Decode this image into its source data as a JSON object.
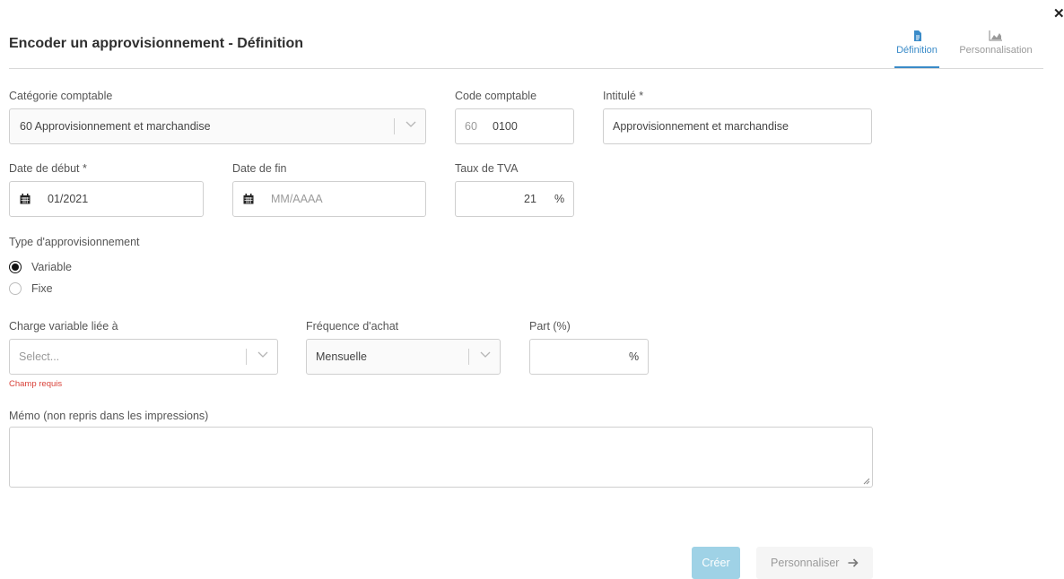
{
  "header": {
    "title": "Encoder un approvisionnement - Définition",
    "close_icon": "close-icon",
    "tabs": [
      {
        "label": "Définition",
        "icon": "document-icon",
        "active": true
      },
      {
        "label": "Personnalisation",
        "icon": "area-chart-icon",
        "active": false
      }
    ],
    "accent_color": "#3a8bc8"
  },
  "form": {
    "categorie": {
      "label": "Catégorie comptable",
      "value": "60 Approvisionnement et marchandise"
    },
    "code": {
      "label": "Code comptable",
      "prefix": "60",
      "value": "0100"
    },
    "intitule": {
      "label": "Intitulé *",
      "value": "Approvisionnement et marchandise"
    },
    "date_debut": {
      "label": "Date de début *",
      "value": "01/2021",
      "icon": "calendar-icon"
    },
    "date_fin": {
      "label": "Date de fin",
      "placeholder": "MM/AAAA",
      "icon": "calendar-icon"
    },
    "tva": {
      "label": "Taux de TVA",
      "value": "21",
      "unit": "%"
    },
    "type": {
      "label": "Type d'approvisionnement",
      "options": [
        {
          "label": "Variable",
          "selected": true
        },
        {
          "label": "Fixe",
          "selected": false
        }
      ]
    },
    "charge": {
      "label": "Charge variable liée à",
      "placeholder": "Select...",
      "error": "Champ requis",
      "error_color": "#d9423a"
    },
    "frequence": {
      "label": "Fréquence d'achat",
      "value": "Mensuelle"
    },
    "part": {
      "label": "Part (%)",
      "unit": "%"
    },
    "memo": {
      "label": "Mémo (non repris dans les impressions)",
      "value": ""
    }
  },
  "footer": {
    "create_label": "Créer",
    "next_label": "Personnaliser",
    "next_icon": "arrow-right-icon",
    "create_color": "#9fd2e6"
  }
}
